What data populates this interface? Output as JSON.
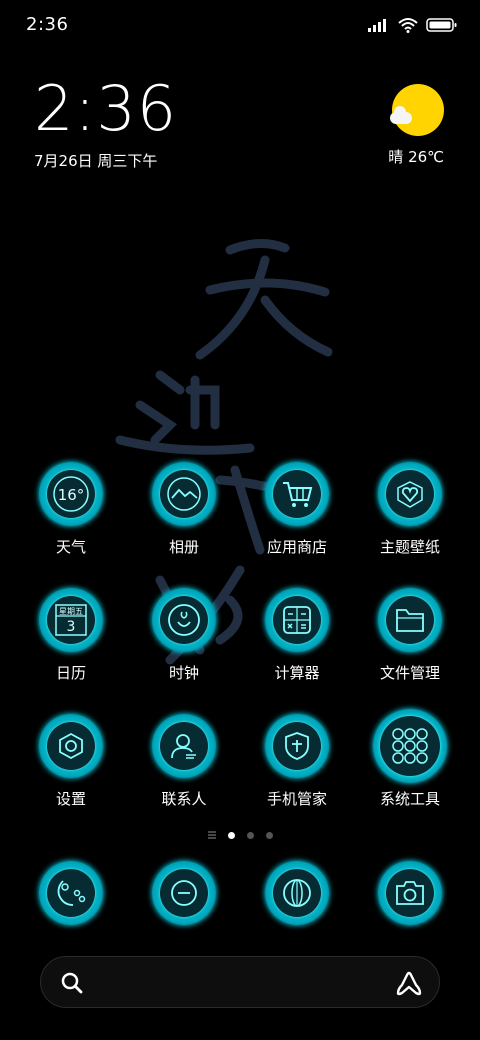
{
  "status_bar": {
    "time": "2:36"
  },
  "clock_widget": {
    "time": "2:36",
    "date": "7月26日 周三下午"
  },
  "weather_widget": {
    "text": "晴 26℃"
  },
  "apps": [
    {
      "label": "天气",
      "icon": "weather-icon",
      "icon_text": "16°"
    },
    {
      "label": "相册",
      "icon": "gallery-icon"
    },
    {
      "label": "应用商店",
      "icon": "cart-icon"
    },
    {
      "label": "主题壁纸",
      "icon": "heart-icon"
    },
    {
      "label": "日历",
      "icon": "calendar-icon",
      "icon_text": "星期五",
      "icon_num": "3"
    },
    {
      "label": "时钟",
      "icon": "clock-icon"
    },
    {
      "label": "计算器",
      "icon": "calculator-icon"
    },
    {
      "label": "文件管理",
      "icon": "folder-icon"
    },
    {
      "label": "设置",
      "icon": "hexagon-settings-icon"
    },
    {
      "label": "联系人",
      "icon": "contact-icon"
    },
    {
      "label": "手机管家",
      "icon": "shield-icon"
    },
    {
      "label": "系统工具",
      "icon": "app-folder-icon"
    }
  ],
  "dock": [
    {
      "icon": "messages-icon"
    },
    {
      "icon": "phone-icon"
    },
    {
      "icon": "browser-icon"
    },
    {
      "icon": "camera-icon"
    }
  ],
  "page_indicator": {
    "count": 3,
    "active": 0
  },
  "colors": {
    "accent": "#00d8f0",
    "background": "#000000",
    "sun": "#ffd400"
  }
}
